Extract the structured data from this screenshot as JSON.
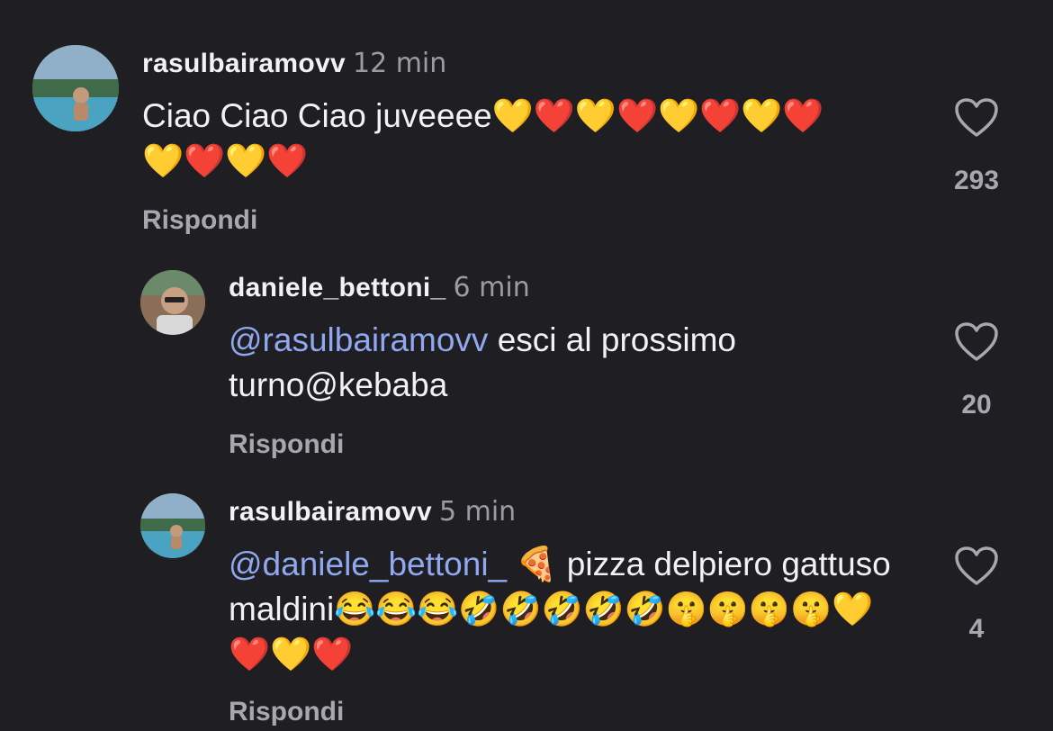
{
  "comments": [
    {
      "username": "rasulbairamovv",
      "time": "12 min",
      "mention": "",
      "text": "Ciao Ciao Ciao juveeee💛❤️💛❤️💛❤️💛❤️💛❤️💛❤️",
      "reply_label": "Rispondi",
      "likes": "293"
    },
    {
      "username": "daniele_bettoni_",
      "time": "6 min",
      "mention": "@rasulbairamovv",
      "text": " esci al prossimo turno@kebaba",
      "reply_label": "Rispondi",
      "likes": "20"
    },
    {
      "username": "rasulbairamovv",
      "time": "5 min",
      "mention": "@daniele_bettoni_",
      "text": " 🍕 pizza delpiero gattuso maldini😂😂😂🤣🤣🤣🤣🤣🤫🤫🤫🤫💛❤️💛❤️",
      "reply_label": "Rispondi",
      "likes": "4"
    }
  ],
  "icons": {
    "like": "heart-outline-icon"
  },
  "colors": {
    "background": "#1f1f23",
    "mention": "#8fa8f0",
    "secondary_text": "#a7a7ad"
  }
}
